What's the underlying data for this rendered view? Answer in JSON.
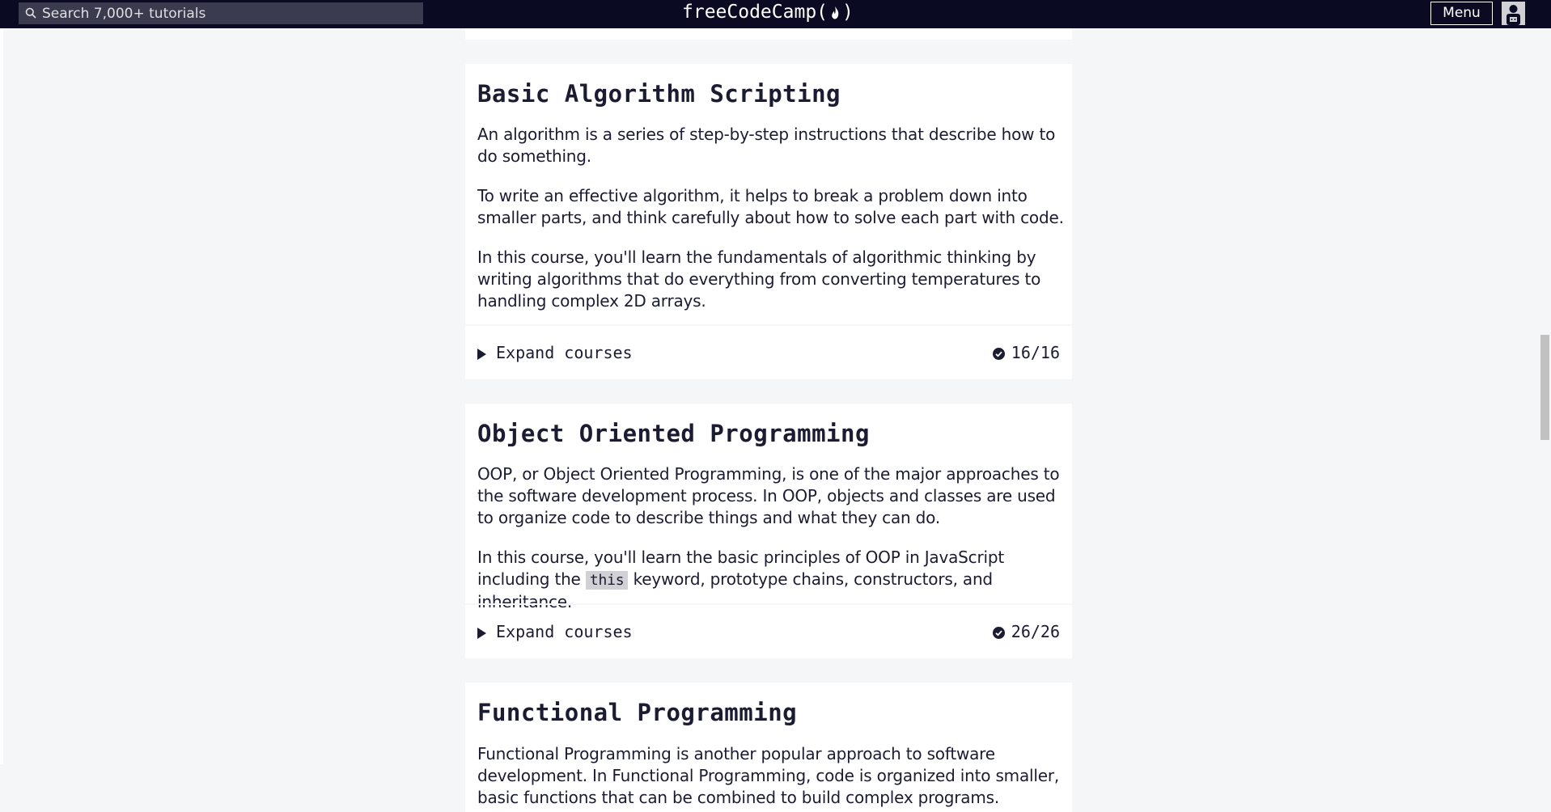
{
  "navbar": {
    "search_placeholder": "Search 7,000+ tutorials",
    "brand": "freeCodeCamp",
    "brand_open": "(",
    "brand_close": ")",
    "menu_label": "Menu",
    "icons": [
      "search-icon",
      "flame-icon",
      "avatar"
    ]
  },
  "cards": [
    {
      "title": "Basic Algorithm Scripting",
      "paragraphs": [
        "An algorithm is a series of step-by-step instructions that describe how to do something.",
        "To write an effective algorithm, it helps to break a problem down into smaller parts, and think carefully about how to solve each part with code.",
        "In this course, you'll learn the fundamentals of algorithmic thinking by writing algorithms that do everything from converting temperatures to handling complex 2D arrays."
      ],
      "expand_label": "Expand courses",
      "progress": "16/16"
    },
    {
      "title": "Object Oriented Programming",
      "paragraphs": [
        "OOP, or Object Oriented Programming, is one of the major approaches to the software development process. In OOP, objects and classes are used to organize code to describe things and what they can do."
      ],
      "p2_before": "In this course, you'll learn the basic principles of OOP in JavaScript including the",
      "p2_code": "this",
      "p2_after": "keyword, prototype chains, constructors, and inheritance.",
      "expand_label": "Expand courses",
      "progress": "26/26"
    },
    {
      "title": "Functional Programming",
      "paragraphs": [
        "Functional Programming is another popular approach to software development. In Functional Programming, code is organized into smaller, basic functions that can be combined to build complex programs."
      ]
    }
  ],
  "colors": {
    "navbar_bg": "#0a0a23",
    "page_bg": "#f5f6f7",
    "text": "#1b1b32"
  }
}
